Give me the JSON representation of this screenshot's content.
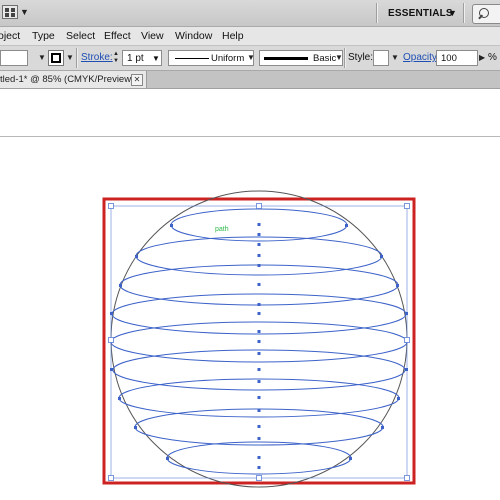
{
  "titlebar": {
    "workspace_label": "ESSENTIALS",
    "workspace_arrow": "▼",
    "bridge_arrow": "▼",
    "icons": [
      "bridge-grid-icon",
      "search-icon"
    ]
  },
  "menubar": {
    "items": [
      "oject",
      "Type",
      "Select",
      "Effect",
      "View",
      "Window",
      "Help"
    ]
  },
  "controlbar": {
    "stroke_label": "Stroke:",
    "stroke_weight": "1 pt",
    "profile_label": "Uniform",
    "brush_label": "Basic",
    "style_label": "Style:",
    "opacity_label": "Opacity:",
    "opacity_value": "100",
    "opacity_unit": "%"
  },
  "document": {
    "tab_title": "tled-1* @ 85% (CMYK/Preview)",
    "close_glyph": "✕"
  },
  "artwork": {
    "smart_guide_label": "path",
    "artboard_border_color": "#cc2222",
    "path_color": "#3d63c9",
    "guide_color": "#2fb84a",
    "circle_color": "#555555"
  }
}
